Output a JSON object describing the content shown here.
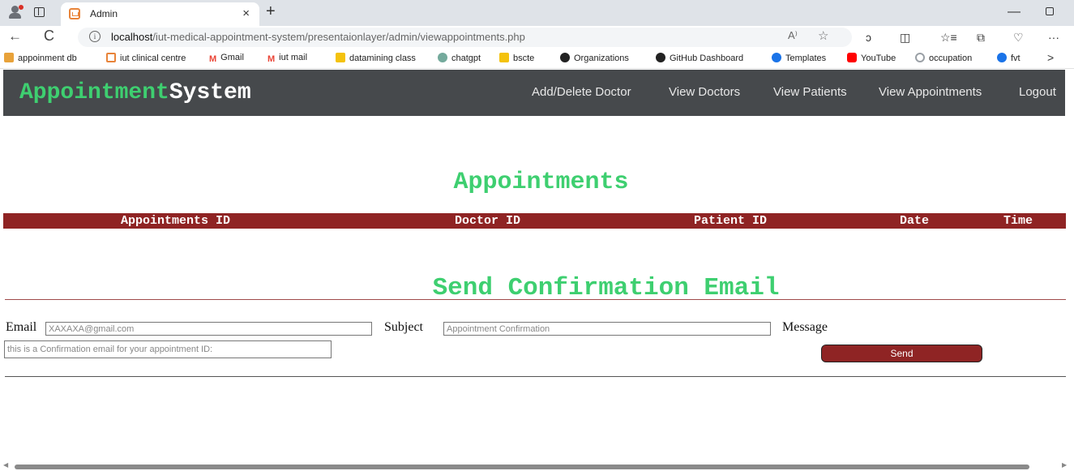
{
  "browser": {
    "tab_title": "Admin",
    "tab_close": "×",
    "new_tab": "+",
    "minimize": "—",
    "back": "←",
    "reload": "C",
    "info": "i",
    "url_host": "localhost",
    "url_path": "/iut-medical-appointment-system/presentaionlayer/admin/viewappointments.php",
    "read_aloud": "A⁾",
    "favorite": "☆",
    "toolbar_icons": [
      "extensions-icon",
      "split-screen-icon",
      "favorites-icon",
      "collections-icon",
      "performance-icon",
      "more-icon"
    ],
    "toolbar_glyphs": [
      "ↄ",
      "◫",
      "☆≡",
      "⧉",
      "♡",
      "···"
    ],
    "bookmarks": [
      {
        "label": "appoinment db",
        "color": "#e8a23a"
      },
      {
        "label": "iut clinical centre",
        "color": "#e8843a"
      },
      {
        "label": "Gmail",
        "color": "#ea4335"
      },
      {
        "label": "iut mail",
        "color": "#ea4335"
      },
      {
        "label": "datamining class",
        "color": "#f4c20d"
      },
      {
        "label": "chatgpt",
        "color": "#74aa9c"
      },
      {
        "label": "bscte",
        "color": "#f4c20d"
      },
      {
        "label": "Organizations",
        "color": "#222222"
      },
      {
        "label": "GitHub Dashboard",
        "color": "#222222"
      },
      {
        "label": "Templates",
        "color": "#1a73e8"
      },
      {
        "label": "YouTube",
        "color": "#ff0000"
      },
      {
        "label": "occupation",
        "color": "#9aa0a6"
      },
      {
        "label": "fvt",
        "color": "#1a73e8"
      }
    ],
    "bookmarks_more": ">"
  },
  "navbar": {
    "brand_part1": "Appointment",
    "brand_part2": "System",
    "links": [
      "Add/Delete Doctor",
      "View Doctors",
      "View Patients",
      "View Appointments",
      "Logout"
    ]
  },
  "appointments": {
    "title": "Appointments",
    "columns": [
      "Appointments ID",
      "Doctor ID",
      "Patient ID",
      "Date",
      "Time"
    ]
  },
  "email_form": {
    "title": "Send Confirmation Email",
    "email_label": "Email",
    "email_value": "XAXAXA@gmail.com",
    "subject_label": "Subject",
    "subject_value": "Appointment Confirmation",
    "message_label": "Message",
    "message_value": "this is a Confirmation email for your appointment ID:",
    "send_label": "Send"
  },
  "colors": {
    "accent_green": "#3ecf70",
    "header_red": "#8f2424",
    "navbar_bg": "#46494c"
  }
}
